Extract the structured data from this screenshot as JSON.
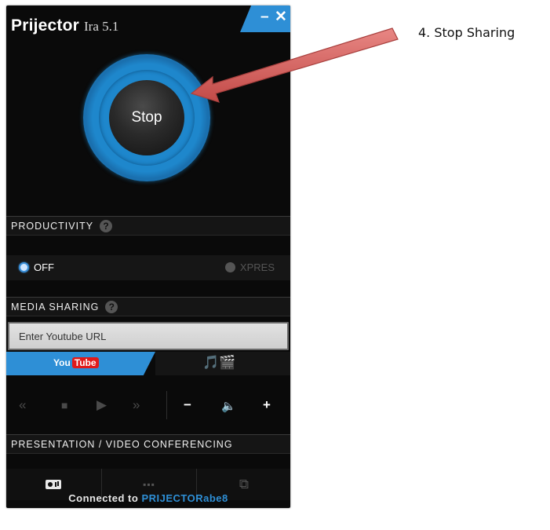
{
  "app": {
    "brand": "Prijector",
    "version": "Ira 5.1",
    "minimize_glyph": "–",
    "close_glyph": "✕"
  },
  "stop_button": {
    "label": "Stop"
  },
  "productivity": {
    "header": "PRODUCTIVITY",
    "help_glyph": "?",
    "options": [
      {
        "label": "OFF",
        "selected": true
      },
      {
        "label": "XPRES",
        "selected": false
      }
    ]
  },
  "media_sharing": {
    "header": "MEDIA SHARING",
    "help_glyph": "?",
    "url_placeholder": "Enter Youtube URL",
    "youtube_you": "You",
    "youtube_tube": "Tube",
    "local_media_icons": "🎵🎬"
  },
  "playback": {
    "rewind": "«",
    "stop": "■",
    "play": "▶",
    "fast_forward": "»",
    "volume_down": "−",
    "volume": "🔈",
    "volume_up": "+"
  },
  "presentation": {
    "header": "PRESENTATION / VIDEO CONFERENCING",
    "grid_glyph": "▪▪▪",
    "share_glyph": "⧉"
  },
  "status": {
    "prefix": "Connected to",
    "device": "PRIJECTORabe8"
  },
  "annotation": {
    "callout": "4. Stop Sharing"
  },
  "colors": {
    "accent": "#2e8fd6",
    "window_bg": "#0a0a0a",
    "arrow": "#d9605d"
  },
  "icons": [
    "minimize-icon",
    "close-icon",
    "help-icon",
    "radio-icon",
    "youtube-logo",
    "media-icon",
    "rewind-icon",
    "stop-icon",
    "play-icon",
    "fast-forward-icon",
    "volume-down-icon",
    "volume-icon",
    "volume-up-icon",
    "presentation-icon",
    "grid-icon",
    "share-screen-icon",
    "arrow-annotation"
  ]
}
